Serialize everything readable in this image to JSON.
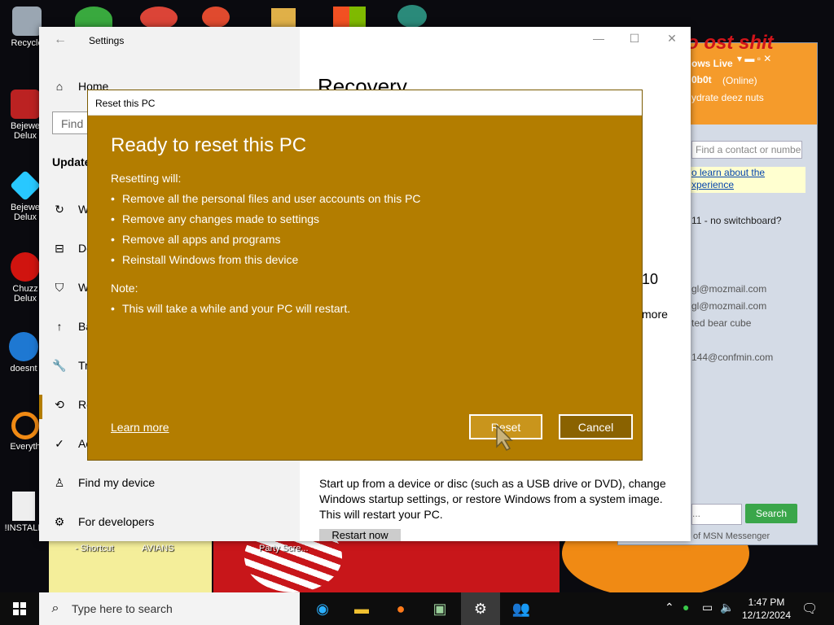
{
  "desktop": {
    "icons": [
      "Recycle",
      "Bejewe Delux",
      "Bejewe Delux",
      "Chuzz Delux",
      "doesnt",
      "Everyth",
      "!INSTALL",
      "- Shortcut",
      "AVIANS",
      "Party Scre..."
    ]
  },
  "settings": {
    "window_title": "Settings",
    "home": "Home",
    "find_placeholder": "Find",
    "section_header": "Update",
    "nav_items": [
      "W",
      "De",
      "W",
      "Ba",
      "Tr",
      "Re",
      "Ac",
      "Find my device",
      "For developers"
    ],
    "page_title": "Recovery",
    "body_text": "Start up from a device or disc (such as a USB drive or DVD), change Windows startup settings, or restore Windows from a system image. This will restart your PC.",
    "restart_button": "Restart now",
    "fragment_10": "10",
    "fragment_more": "more"
  },
  "dialog": {
    "window_title": "Reset this PC",
    "heading": "Ready to reset this PC",
    "resetting_label": "Resetting will:",
    "bullets": [
      "Remove all the personal files and user accounts on this PC",
      "Remove any changes made to settings",
      "Remove all apps and programs",
      "Reinstall Windows from this device"
    ],
    "note_label": "Note:",
    "note_bullets": [
      "This will take a while and your PC will restart."
    ],
    "learn_more": "Learn more",
    "reset_button": "Reset",
    "cancel_button": "Cancel"
  },
  "messenger": {
    "title": "ows Live",
    "user": "0b0t",
    "status": "(Online)",
    "personal_message": "ydrate deez nuts",
    "find_placeholder": "Find a contact or numbe",
    "learn_link_1": "o learn about the",
    "learn_link_2": "xperience",
    "contacts": [
      "11 - no switchboard?",
      "gl@mozmail.com",
      "gl@mozmail.com",
      "ted bear cube",
      "144@confmin.com"
    ],
    "search_button": "Search",
    "footer": "of MSN Messenger",
    "overlay_text": "o ost shit"
  },
  "taskbar": {
    "search_placeholder": "Type here to search",
    "time": "1:47 PM",
    "date": "12/12/2024"
  },
  "colors": {
    "dialog_bg": "#b37d00",
    "accent": "#f59b2b"
  }
}
